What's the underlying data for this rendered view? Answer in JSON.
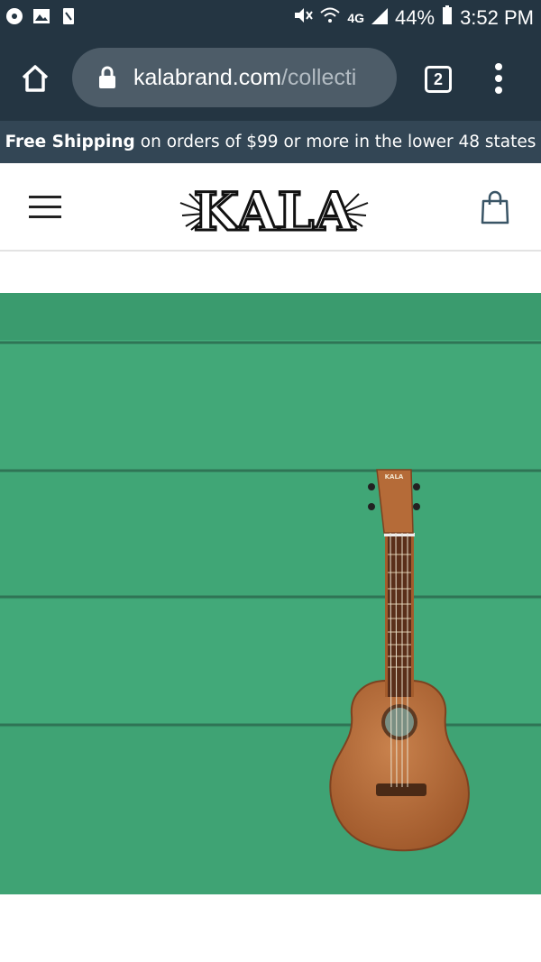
{
  "status_bar": {
    "battery": "44%",
    "time": "3:52 PM",
    "network": "4G"
  },
  "browser": {
    "url_domain": "kalabrand.com",
    "url_path": "/collecti",
    "tab_count": "2"
  },
  "banner": {
    "bold": "Free Shipping",
    "rest": "on orders of $99 or more in the lower 48 states"
  },
  "header": {
    "logo_text": "KALA"
  },
  "hero": {
    "headstock_brand": "KALA"
  },
  "icons": [
    "home-icon",
    "lock-icon",
    "tabs-icon",
    "more-vert-icon",
    "menu-icon",
    "shopping-bag-icon"
  ],
  "colors": {
    "browser_chrome": "#243542",
    "banner_bg": "#334655",
    "wall_green": "#3fa676",
    "ukulele_wood": "#b4693a"
  }
}
